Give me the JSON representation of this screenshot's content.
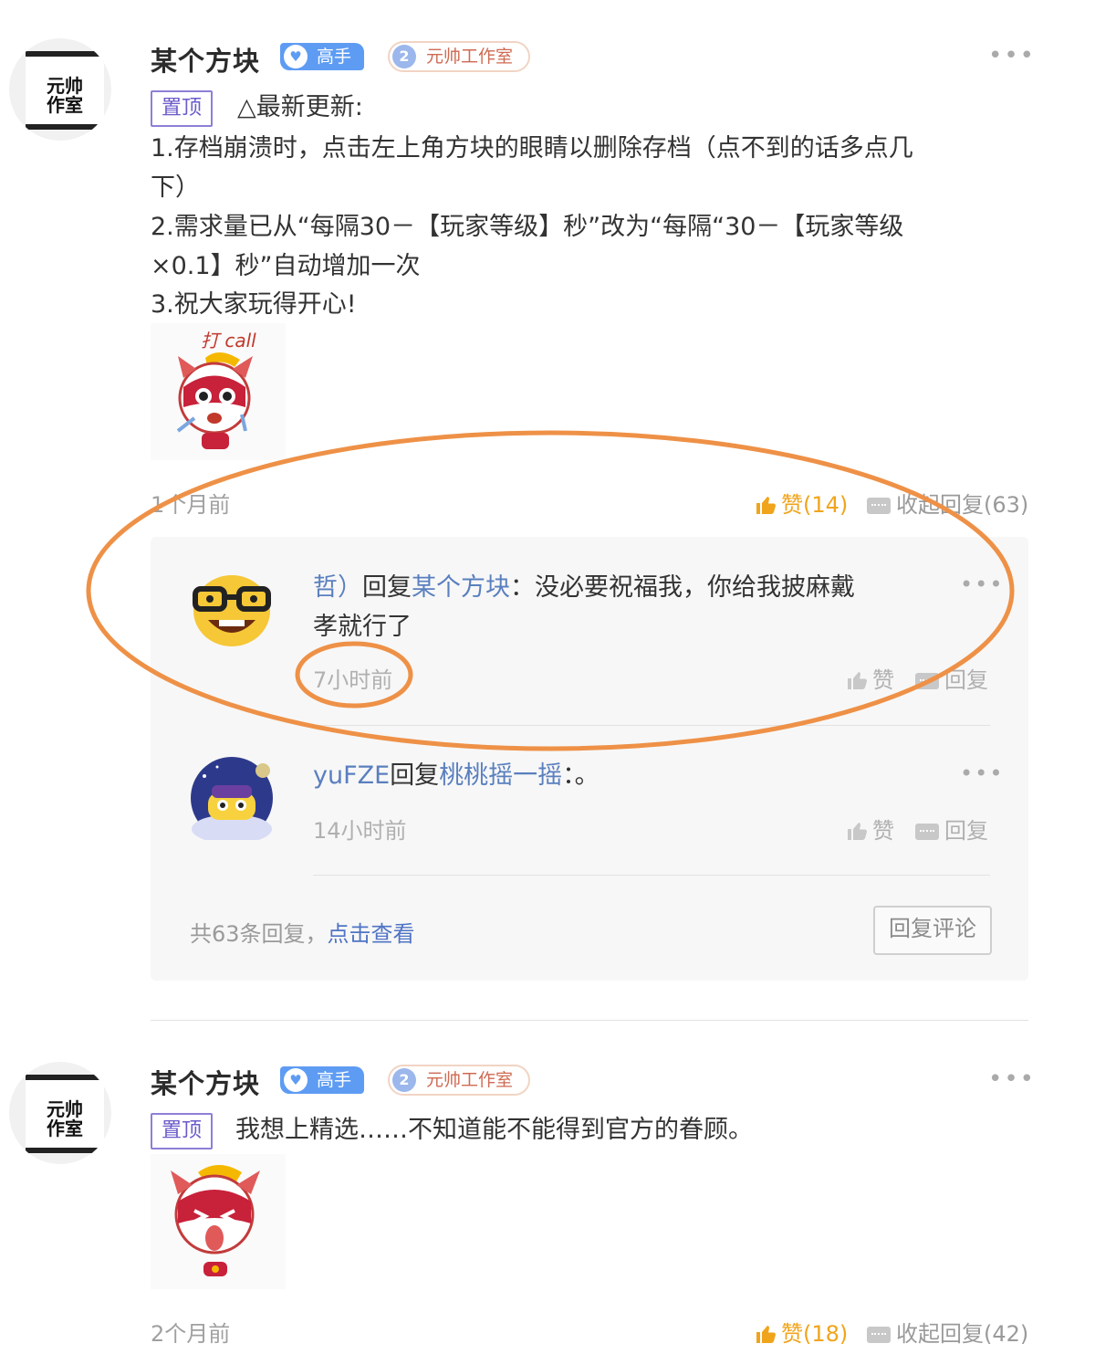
{
  "comments": [
    {
      "author": "某个方块",
      "avatar_text": "元帅\n工作室",
      "badge_master": "高手",
      "badge_studio_num": "2",
      "badge_studio": "元帅工作室",
      "pin_label": "置顶",
      "lines": [
        "△最新更新:",
        "1.存档崩溃时，点击左上角方块的眼睛以删除存档（点不到的话多点几",
        "下）",
        "2.需求量已从“每隔30－【玩家等级】秒”改为“每隔“30－【玩家等级",
        "×0.1】秒”自动增加一次",
        "3.祝大家玩得开心!"
      ],
      "sticker_text": "打 call",
      "time": "1个月前",
      "like_label": "赞(14)",
      "collapse_label": "收起回复(63)",
      "replies": [
        {
          "user": "哲）",
          "verb": "回复",
          "target": "某个方块",
          "text_line1": "：没必要祝福我，你给我披麻戴",
          "text_line2": "孝就行了",
          "time": "7小时前",
          "like": "赞",
          "reply": "回复"
        },
        {
          "user": "yuFZE",
          "verb": "回复",
          "target": "桃桃摇一摇",
          "text_line1": "：。",
          "text_line2": "",
          "time": "14小时前",
          "like": "赞",
          "reply": "回复"
        }
      ],
      "total_replies": "共63条回复，",
      "view_link": "点击查看",
      "reply_button": "回复评论"
    },
    {
      "author": "某个方块",
      "badge_master": "高手",
      "badge_studio_num": "2",
      "badge_studio": "元帅工作室",
      "pin_label": "置顶",
      "text": "我想上精选……不知道能不能得到官方的眷顾。",
      "time": "2个月前",
      "like_label": "赞(18)",
      "collapse_label": "收起回复(42)"
    }
  ],
  "colors": {
    "accent_blue": "#5e9cf3",
    "link_blue": "#5a7fbf",
    "like_orange": "#f0a41c",
    "annotation_orange": "#ee9147"
  }
}
